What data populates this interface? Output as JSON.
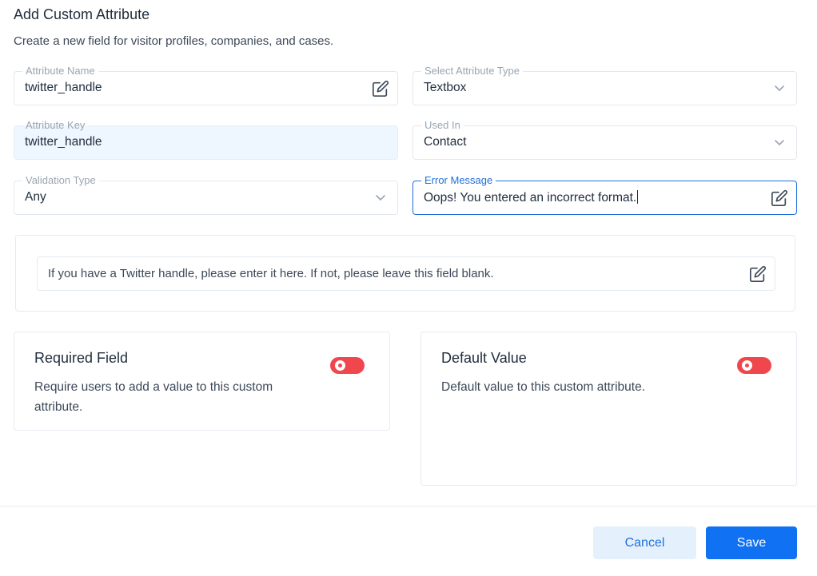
{
  "header": {
    "title": "Add Custom Attribute",
    "subtitle": "Create a new field for visitor profiles, companies, and cases."
  },
  "fields": {
    "attribute_name": {
      "label": "Attribute Name",
      "value": "twitter_handle",
      "icon": "edit-icon"
    },
    "attribute_type": {
      "label": "Select Attribute Type",
      "value": "Textbox",
      "icon": "chevron-down-icon"
    },
    "attribute_key": {
      "label": "Attribute Key",
      "value": "twitter_handle"
    },
    "used_in": {
      "label": "Used In",
      "value": "Contact",
      "icon": "chevron-down-icon"
    },
    "validation_type": {
      "label": "Validation Type",
      "value": "Any",
      "icon": "chevron-down-icon"
    },
    "error_message": {
      "label": "Error Message",
      "value": "Oops! You entered an incorrect format.",
      "icon": "edit-icon"
    }
  },
  "hint": {
    "value": "If you have a Twitter handle, please enter it here. If not, please leave this field blank.",
    "icon": "edit-icon"
  },
  "options": {
    "required": {
      "title": "Required Field",
      "line1": "Require users to add a value to this custom",
      "line2": "attribute.",
      "enabled": false
    },
    "default": {
      "title": "Default Value",
      "line1": "Default value to this custom attribute.",
      "enabled": false
    }
  },
  "footer": {
    "cancel_label": "Cancel",
    "save_label": "Save"
  },
  "colors": {
    "accent": "#1071f2",
    "toggle_off": "#f0474f",
    "readonly_bg": "#eef6ff"
  }
}
